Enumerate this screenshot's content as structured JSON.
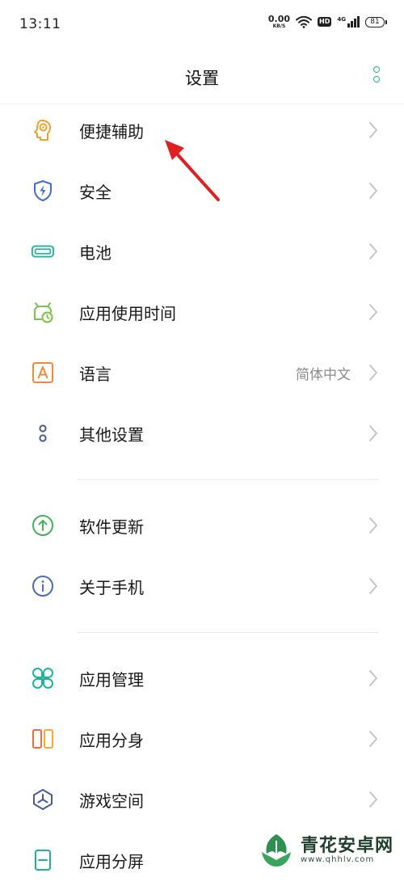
{
  "status_bar": {
    "time": "13:11",
    "net_speed_value": "0.00",
    "net_speed_unit": "KB/S",
    "hd_badge": "HD",
    "network_type": "4G",
    "battery_level": "81",
    "icons": [
      "wifi-icon",
      "hd-icon",
      "signal-icon",
      "battery-icon"
    ]
  },
  "header": {
    "title": "设置",
    "more_icon": "vertical-dots-icon",
    "accent_color": "#2bb673"
  },
  "sections": [
    {
      "items": [
        {
          "label": "便捷辅助",
          "icon": "head-accessibility-icon",
          "icon_color": "#f0a030"
        },
        {
          "label": "安全",
          "icon": "shield-bolt-icon",
          "icon_color": "#3e6fd8"
        },
        {
          "label": "电池",
          "icon": "battery-icon",
          "icon_color": "#1fb59a"
        },
        {
          "label": "应用使用时间",
          "icon": "app-clock-icon",
          "icon_color": "#7cc24a"
        },
        {
          "label": "语言",
          "value": "简体中文",
          "icon": "letter-a-icon",
          "icon_color": "#f08a3a"
        },
        {
          "label": "其他设置",
          "icon": "two-circles-icon",
          "icon_color": "#4a5a8a"
        }
      ]
    },
    {
      "items": [
        {
          "label": "软件更新",
          "icon": "arrow-up-circle-icon",
          "icon_color": "#46b15a"
        },
        {
          "label": "关于手机",
          "icon": "info-circle-icon",
          "icon_color": "#4a6db5"
        }
      ]
    },
    {
      "items": [
        {
          "label": "应用管理",
          "icon": "four-petals-icon",
          "icon_color": "#19b49a"
        },
        {
          "label": "应用分身",
          "icon": "dual-app-icon",
          "icon_color": "#f06a3a"
        },
        {
          "label": "游戏空间",
          "icon": "game-triangle-icon",
          "icon_color": "#4a5a9a"
        },
        {
          "label": "应用分屏",
          "icon": "split-screen-icon",
          "icon_color": "#19b49a"
        }
      ]
    }
  ],
  "annotation": {
    "arrow_color": "#e02020"
  },
  "watermark": {
    "title": "青花安卓网",
    "url": "www.qhhlv.com"
  }
}
